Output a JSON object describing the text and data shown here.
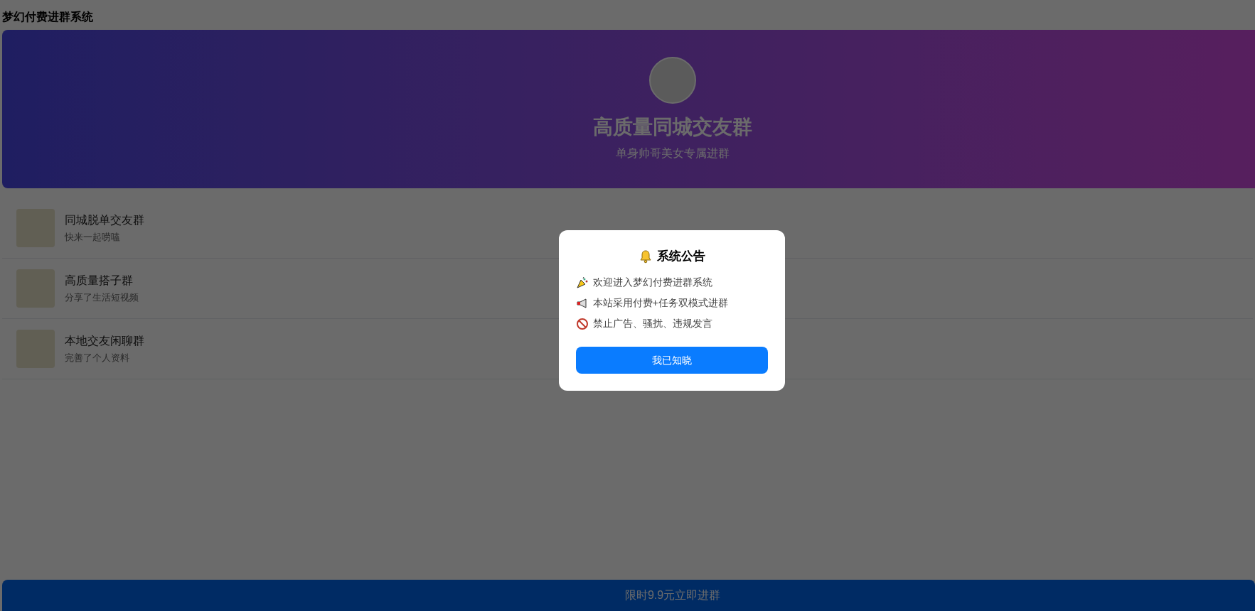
{
  "page_title": "梦幻付费进群系统",
  "banner": {
    "title": "高质量同城交友群",
    "subtitle": "单身帅哥美女专属进群"
  },
  "groups": [
    {
      "name": "同城脱单交友群",
      "description": "快来一起唠嗑"
    },
    {
      "name": "高质量搭子群",
      "description": "分享了生活短视频"
    },
    {
      "name": "本地交友闲聊群",
      "description": "完善了个人资料"
    }
  ],
  "join_button": "限时9.9元立即进群",
  "notice_dialog": {
    "title": "系统公告",
    "lines": [
      {
        "kind": "party",
        "text": "欢迎进入梦幻付费进群系统"
      },
      {
        "kind": "megaphone",
        "text": "本站采用付费+任务双模式进群"
      },
      {
        "kind": "prohibited",
        "text": "禁止广告、骚扰、违规发言"
      }
    ],
    "confirm_button": "我已知晓"
  }
}
